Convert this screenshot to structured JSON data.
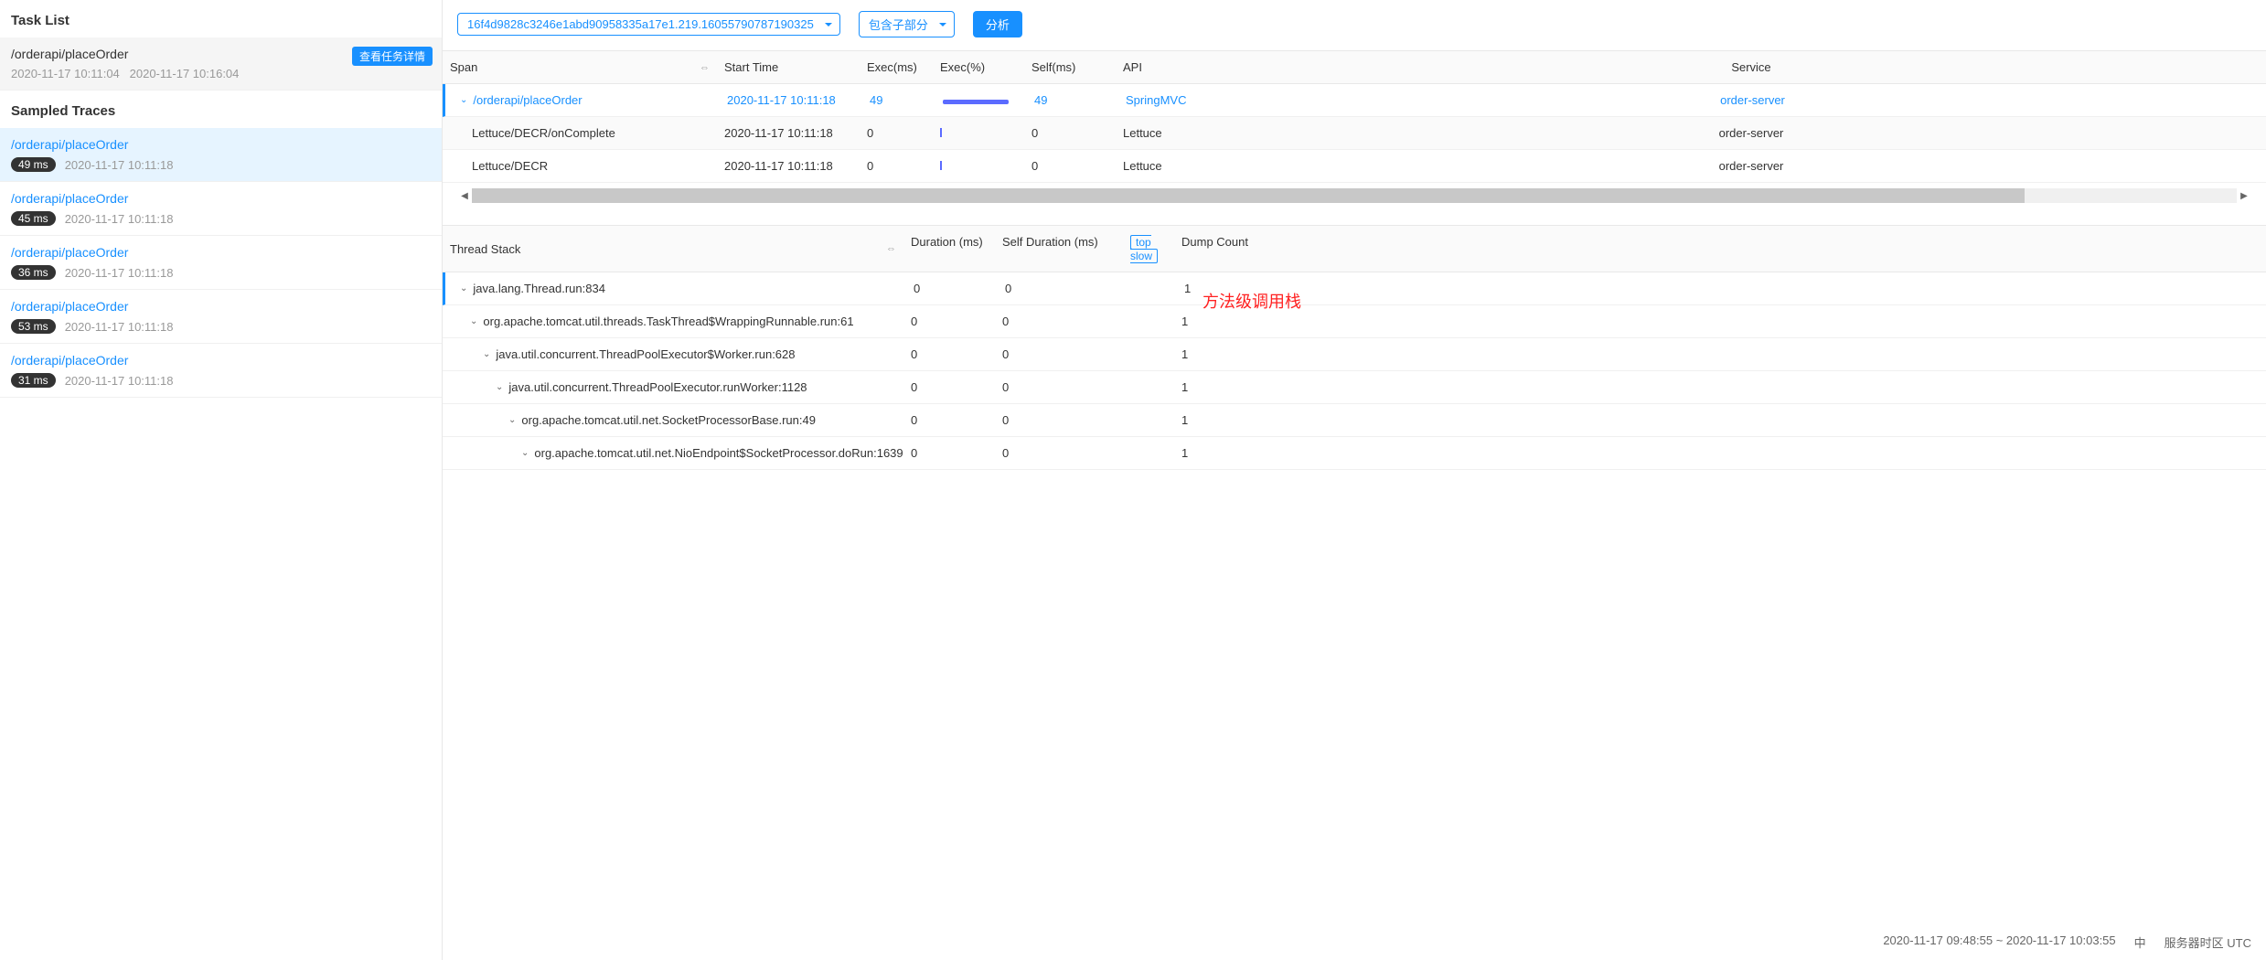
{
  "left": {
    "taskListTitle": "Task List",
    "task": {
      "name": "/orderapi/placeOrder",
      "startTime": "2020-11-17 10:11:04",
      "endTime": "2020-11-17 10:16:04",
      "detailBtn": "查看任务详情"
    },
    "sampledTitle": "Sampled Traces",
    "traces": [
      {
        "name": "/orderapi/placeOrder",
        "duration": "49 ms",
        "time": "2020-11-17 10:11:18",
        "selected": true
      },
      {
        "name": "/orderapi/placeOrder",
        "duration": "45 ms",
        "time": "2020-11-17 10:11:18",
        "selected": false
      },
      {
        "name": "/orderapi/placeOrder",
        "duration": "36 ms",
        "time": "2020-11-17 10:11:18",
        "selected": false
      },
      {
        "name": "/orderapi/placeOrder",
        "duration": "53 ms",
        "time": "2020-11-17 10:11:18",
        "selected": false
      },
      {
        "name": "/orderapi/placeOrder",
        "duration": "31 ms",
        "time": "2020-11-17 10:11:18",
        "selected": false
      }
    ]
  },
  "toolbar": {
    "traceId": "16f4d9828c3246e1abd90958335a17e1.219.16055790787190325",
    "filter": "包含子部分",
    "analyzeBtn": "分析"
  },
  "spanTable": {
    "headers": {
      "span": "Span",
      "start": "Start Time",
      "exec": "Exec(ms)",
      "execpct": "Exec(%)",
      "self": "Self(ms)",
      "api": "API",
      "service": "Service"
    },
    "rows": [
      {
        "indent": 0,
        "expand": true,
        "name": "/orderapi/placeOrder",
        "start": "2020-11-17 10:11:18",
        "exec": "49",
        "bar": "full",
        "self": "49",
        "api": "SpringMVC",
        "service": "order-server",
        "active": true
      },
      {
        "indent": 1,
        "expand": false,
        "name": "Lettuce/DECR/onComplete",
        "start": "2020-11-17 10:11:18",
        "exec": "0",
        "bar": "tiny",
        "self": "0",
        "api": "Lettuce",
        "service": "order-server",
        "even": true
      },
      {
        "indent": 1,
        "expand": false,
        "name": "Lettuce/DECR",
        "start": "2020-11-17 10:11:18",
        "exec": "0",
        "bar": "tiny",
        "self": "0",
        "api": "Lettuce",
        "service": "order-server"
      }
    ]
  },
  "stackTable": {
    "headers": {
      "stack": "Thread Stack",
      "dur": "Duration (ms)",
      "self": "Self Duration (ms)",
      "top": "top slow",
      "dump": "Dump Count"
    },
    "annotation": "方法级调用栈",
    "rows": [
      {
        "indent": 0,
        "name": "java.lang.Thread.run:834",
        "dur": "0",
        "self": "0",
        "dump": "1",
        "active": true
      },
      {
        "indent": 1,
        "name": "org.apache.tomcat.util.threads.TaskThread$WrappingRunnable.run:61",
        "dur": "0",
        "self": "0",
        "dump": "1"
      },
      {
        "indent": 2,
        "name": "java.util.concurrent.ThreadPoolExecutor$Worker.run:628",
        "dur": "0",
        "self": "0",
        "dump": "1"
      },
      {
        "indent": 3,
        "name": "java.util.concurrent.ThreadPoolExecutor.runWorker:1128",
        "dur": "0",
        "self": "0",
        "dump": "1"
      },
      {
        "indent": 4,
        "name": "org.apache.tomcat.util.net.SocketProcessorBase.run:49",
        "dur": "0",
        "self": "0",
        "dump": "1"
      },
      {
        "indent": 5,
        "name": "org.apache.tomcat.util.net.NioEndpoint$SocketProcessor.doRun:1639",
        "dur": "0",
        "self": "0",
        "dump": "1"
      }
    ]
  },
  "footer": {
    "timeRange": "2020-11-17 09:48:55 ~ 2020-11-17 10:03:55",
    "lang": "中",
    "tz": "服务器时区 UTC"
  }
}
